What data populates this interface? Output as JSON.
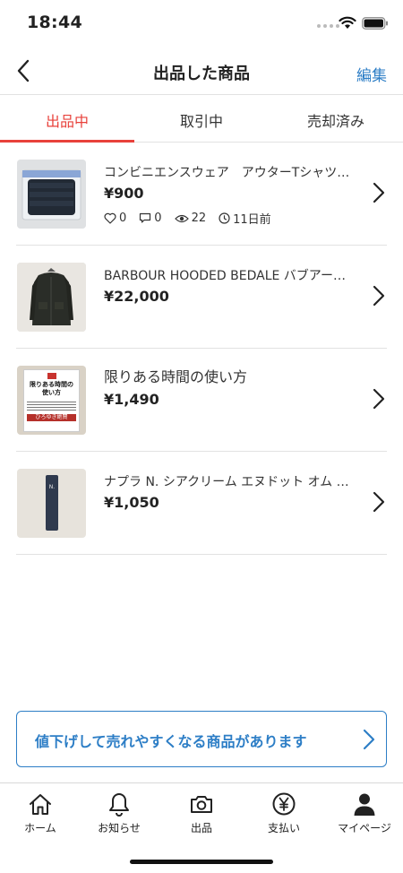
{
  "status_bar": {
    "time": "18:44"
  },
  "nav": {
    "title": "出品した商品",
    "edit_label": "編集"
  },
  "tabs": [
    {
      "label": "出品中",
      "active": true
    },
    {
      "label": "取引中",
      "active": false
    },
    {
      "label": "売却済み",
      "active": false
    }
  ],
  "items": [
    {
      "title": "コンビニエンスウェア　アウターTシャツ…",
      "price": "¥900",
      "likes": "0",
      "comments": "0",
      "views": "22",
      "time_ago": "11日前"
    },
    {
      "title": "BARBOUR HOODED BEDALE バブアー…",
      "price": "¥22,000"
    },
    {
      "title": "限りある時間の使い方",
      "price": "¥1,490",
      "book_cover_text": "限りある時間の使い方",
      "book_author": "ひろゆき絶賛"
    },
    {
      "title": "ナプラ N. シアクリーム エヌドット オム S…",
      "price": "¥1,050",
      "bottle_text": "N."
    }
  ],
  "banner": {
    "text": "値下げして売れやすくなる商品があります"
  },
  "tab_bar": [
    {
      "label": "ホーム",
      "icon": "home-icon"
    },
    {
      "label": "お知らせ",
      "icon": "bell-icon"
    },
    {
      "label": "出品",
      "icon": "camera-icon"
    },
    {
      "label": "支払い",
      "icon": "yen-icon"
    },
    {
      "label": "マイページ",
      "icon": "person-icon"
    }
  ],
  "colors": {
    "accent_red": "#e8413b",
    "link_blue": "#2d7ec6"
  }
}
